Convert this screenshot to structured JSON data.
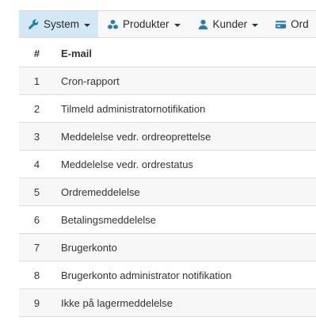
{
  "nav": {
    "items": [
      {
        "label": "System",
        "icon": "wrench-icon",
        "active": true,
        "dropdown": true
      },
      {
        "label": "Produkter",
        "icon": "cubes-icon",
        "active": false,
        "dropdown": true
      },
      {
        "label": "Kunder",
        "icon": "user-icon",
        "active": false,
        "dropdown": true
      },
      {
        "label": "Ord",
        "icon": "credit-card-icon",
        "active": false,
        "dropdown": false
      }
    ]
  },
  "table": {
    "headers": {
      "num": "#",
      "email": "E-mail"
    },
    "rows": [
      {
        "num": "1",
        "email": "Cron-rapport"
      },
      {
        "num": "2",
        "email": "Tilmeld administratornotifikation"
      },
      {
        "num": "3",
        "email": "Meddelelse vedr. ordreoprettelse"
      },
      {
        "num": "4",
        "email": "Meddelelse vedr. ordrestatus"
      },
      {
        "num": "5",
        "email": "Ordremeddelelse"
      },
      {
        "num": "6",
        "email": "Betalingsmeddelelse"
      },
      {
        "num": "7",
        "email": "Brugerkonto"
      },
      {
        "num": "8",
        "email": "Brugerkonto administrator notifikation"
      },
      {
        "num": "9",
        "email": "Ikke på lagermeddelelse"
      }
    ]
  },
  "colors": {
    "accent": "#2a7ab3",
    "active_bg": "#d2e9f5"
  }
}
